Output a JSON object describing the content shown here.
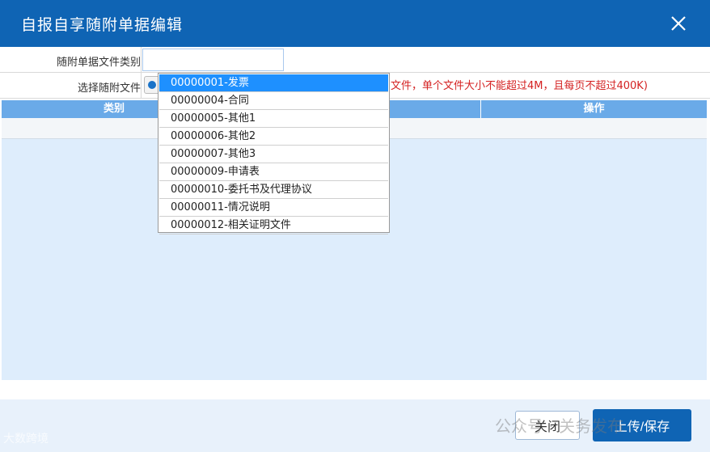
{
  "dialog": {
    "title": "自报自享随附单据编辑"
  },
  "form": {
    "category_label": "随附单据文件类别",
    "category_value": "",
    "file_label": "选择随附文件",
    "file_hint": "文件，单个文件大小不能超过4M，且每页不超过400K)"
  },
  "table": {
    "columns": [
      "类别",
      "操作"
    ]
  },
  "dropdown": {
    "selected_index": 0,
    "options": [
      "00000001-发票",
      "00000004-合同",
      "00000005-其他1",
      "00000006-其他2",
      "00000007-其他3",
      "00000009-申请表",
      "00000010-委托书及代理协议",
      "00000011-情况说明",
      "00000012-相关证明文件"
    ]
  },
  "buttons": {
    "close": "关闭",
    "upload_save": "上传/保存"
  },
  "watermarks": {
    "right": "公众号 · 关务发布",
    "left": "大数跨境"
  },
  "colors": {
    "primary": "#0f64b4",
    "header": "#6aaae8",
    "selected": "#1e90ff",
    "hint": "#d42222",
    "panel": "#deedfc"
  },
  "icons": {
    "close": "close-icon",
    "file": "file-select-icon"
  }
}
